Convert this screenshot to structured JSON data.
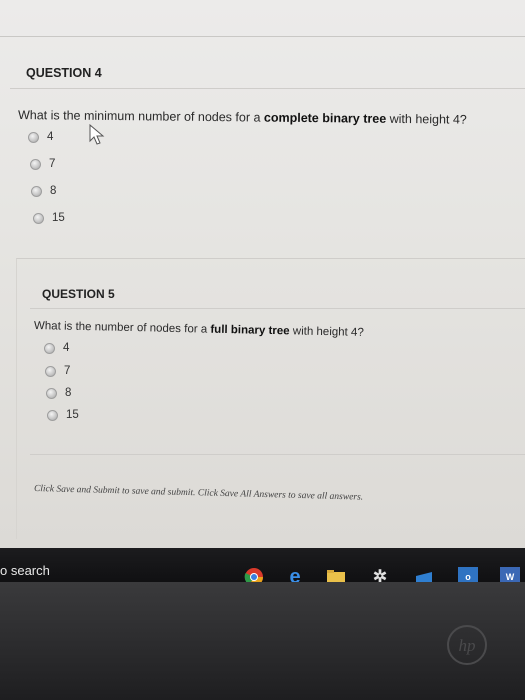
{
  "questions": [
    {
      "heading": "QUESTION 4",
      "text_before": "What is the minimum number of nodes for a ",
      "text_bold": "complete binary tree",
      "text_after": " with height 4?",
      "options": [
        "4",
        "7",
        "8",
        "15"
      ]
    },
    {
      "heading": "QUESTION 5",
      "text_before": "What is the number of nodes for a ",
      "text_bold": "full binary tree",
      "text_after": " with height 4?",
      "options": [
        "4",
        "7",
        "8",
        "15"
      ]
    }
  ],
  "footer_note": "Click Save and Submit to save and submit. Click Save All Answers to save all answers.",
  "taskbar": {
    "search_text": "o search",
    "icons": [
      "chrome-icon",
      "edge-icon",
      "file-explorer-icon",
      "settings-icon",
      "store-icon",
      "outlook-icon",
      "word-icon"
    ],
    "outlook_label": "o",
    "word_label": "W"
  },
  "laptop_brand": "hp",
  "colors": {
    "chrome": "#e8a21b",
    "edge": "#3a8ee6",
    "folder": "#e9c04a",
    "outlook": "#2f73c2",
    "word": "#3b68b5"
  }
}
